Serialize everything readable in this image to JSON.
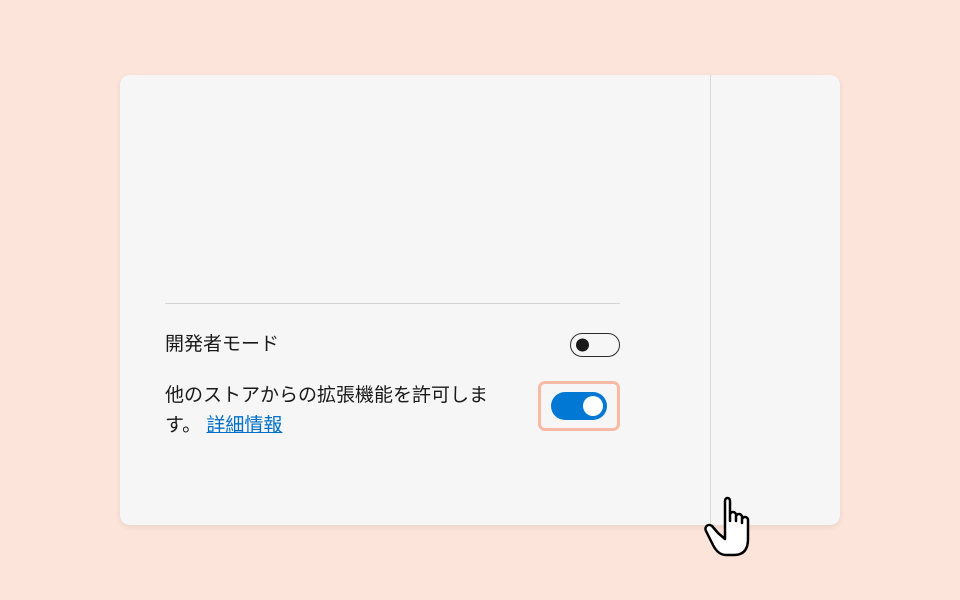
{
  "settings": {
    "developer_mode": {
      "label": "開発者モード",
      "value": false
    },
    "allow_other_stores": {
      "label_part1": "他のストアからの拡張機能を許可します。",
      "more_info": "詳細情報",
      "value": true
    }
  },
  "colors": {
    "accent": "#0078d4",
    "highlight": "#f8baa5",
    "link": "#006fc7"
  }
}
